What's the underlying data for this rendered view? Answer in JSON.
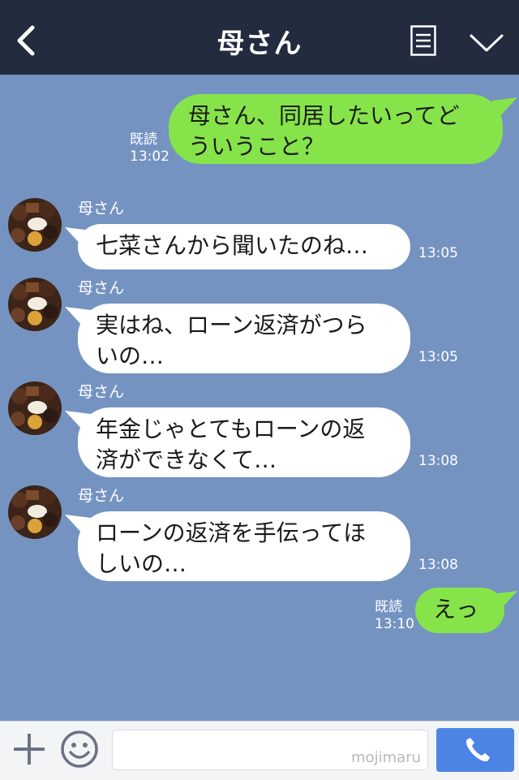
{
  "header": {
    "title": "母さん",
    "back_icon": "back-chevron-icon",
    "note_icon": "note-icon",
    "menu_icon": "chevron-down-icon"
  },
  "colors": {
    "header_bg": "#232b3f",
    "chat_bg": "#7493c1",
    "outgoing": "#86e44a",
    "incoming": "#ffffff",
    "call_button": "#4c84e6"
  },
  "messages": [
    {
      "id": "m1",
      "direction": "outgoing",
      "lines": [
        "母さん、同居したいってど",
        "ういうこと？"
      ],
      "read": "既読",
      "time": "13:02"
    },
    {
      "id": "m2",
      "direction": "incoming",
      "sender": "母さん",
      "lines": [
        "七菜さんから聞いたのね…"
      ],
      "time": "13:05"
    },
    {
      "id": "m3",
      "direction": "incoming",
      "sender": "母さん",
      "lines": [
        "実はね、ローン返済がつら",
        "いの…"
      ],
      "time": "13:05"
    },
    {
      "id": "m4",
      "direction": "incoming",
      "sender": "母さん",
      "lines": [
        "年金じゃとてもローンの返",
        "済ができなくて…"
      ],
      "time": "13:08"
    },
    {
      "id": "m5",
      "direction": "incoming",
      "sender": "母さん",
      "lines": [
        "ローンの返済を手伝ってほ",
        "しいの…"
      ],
      "time": "13:08"
    },
    {
      "id": "m6",
      "direction": "outgoing",
      "lines": [
        "えっ"
      ],
      "read": "既読",
      "time": "13:10"
    }
  ],
  "bottom_bar": {
    "plus_icon": "plus-icon",
    "emoji_icon": "smile-icon",
    "input_value": "",
    "watermark": "mojimaru",
    "call_icon": "phone-icon"
  }
}
